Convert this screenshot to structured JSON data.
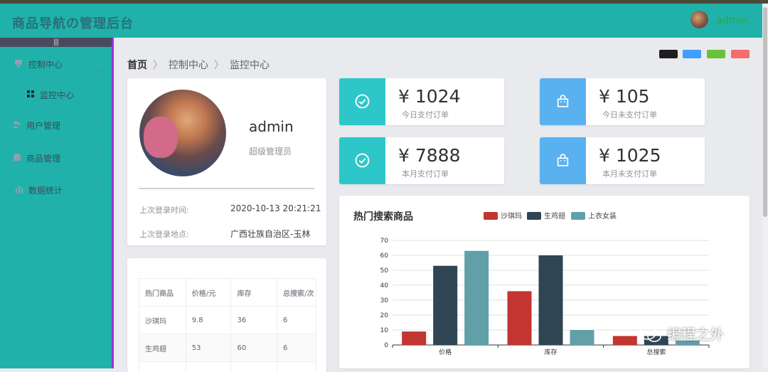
{
  "app": {
    "title": "商品导航の管理后台",
    "user": "admin"
  },
  "sidebar": {
    "collapse_label": "|||",
    "items": [
      {
        "label": "控制中心",
        "icon": "monitor-icon"
      },
      {
        "label": "监控中心",
        "icon": "grid-icon"
      },
      {
        "label": "用户管理",
        "icon": "users-icon"
      },
      {
        "label": "商品管理",
        "icon": "box-icon"
      },
      {
        "label": "数据统计",
        "icon": "bar-chart-icon"
      }
    ]
  },
  "breadcrumb": {
    "home": "首页",
    "level1": "控制中心",
    "level2": "监控中心"
  },
  "theme_colors": [
    "#1e1e1e",
    "#409eff",
    "#67c23a",
    "#f56c6c"
  ],
  "profile": {
    "name": "admin",
    "role": "超级管理员",
    "last_login_time_label": "上次登录时间:",
    "last_login_time": "2020-10-13 20:21:21",
    "last_login_place_label": "上次登录地点:",
    "last_login_place": "广西壮族自治区-玉林"
  },
  "hot_table": {
    "headers": [
      "热门商品",
      "价格/元",
      "库存",
      "总搜索/次"
    ],
    "rows": [
      [
        "沙琪玛",
        "9.8",
        "36",
        "6"
      ],
      [
        "生鸡翅",
        "53",
        "60",
        "6"
      ]
    ]
  },
  "stats": [
    {
      "value": "¥ 1024",
      "label": "今日支付订单",
      "icon": "check-icon",
      "color": "#2ec7c9"
    },
    {
      "value": "¥ 105",
      "label": "今日未支付订单",
      "icon": "shopping-bag-icon",
      "color": "#5ab1ef"
    },
    {
      "value": "¥ 7888",
      "label": "本月支付订单",
      "icon": "check-icon",
      "color": "#2ec7c9"
    },
    {
      "value": "¥ 1025",
      "label": "本月未支付订单",
      "icon": "shopping-bag-icon",
      "color": "#5ab1ef"
    }
  ],
  "watermark": "编程之外",
  "chart_data": {
    "type": "bar",
    "title": "热门搜索商品",
    "categories": [
      "价格",
      "库存",
      "总搜索"
    ],
    "series": [
      {
        "name": "沙琪玛",
        "values": [
          9,
          36,
          6
        ],
        "color": "#c23531"
      },
      {
        "name": "生鸡翅",
        "values": [
          53,
          60,
          6
        ],
        "color": "#2f4554"
      },
      {
        "name": "上衣女装",
        "values": [
          63,
          10,
          3
        ],
        "color": "#61a0a8"
      }
    ],
    "ylim": [
      0,
      70
    ],
    "yticks": [
      0,
      10,
      20,
      30,
      40,
      50,
      60,
      70
    ],
    "grid": true,
    "legend": "top-center"
  }
}
